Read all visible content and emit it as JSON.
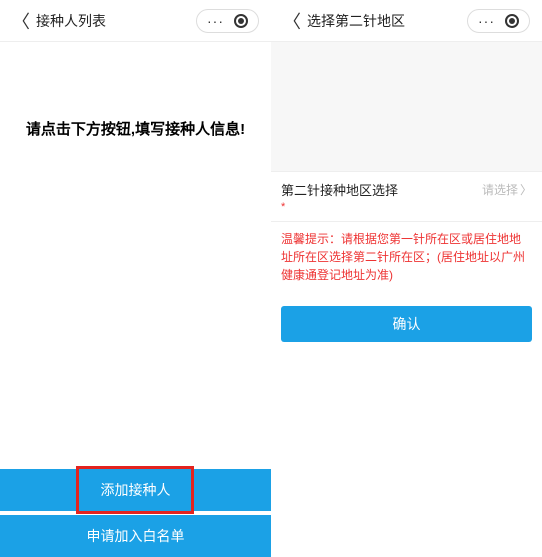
{
  "left": {
    "header": {
      "title": "接种人列表"
    },
    "message": "请点击下方按钮,填写接种人信息!",
    "add_button": "添加接种人",
    "whitelist_button": "申请加入白名单"
  },
  "right": {
    "header": {
      "title": "选择第二针地区"
    },
    "field": {
      "label": "第二针接种地区选择",
      "placeholder": "请选择",
      "required_mark": "*"
    },
    "tip": "温馨提示：请根据您第一针所在区或居住地地址所在区选择第二针所在区；(居住地址以广州健康通登记地址为准)",
    "confirm": "确认"
  },
  "icons": {
    "dots": "···"
  }
}
